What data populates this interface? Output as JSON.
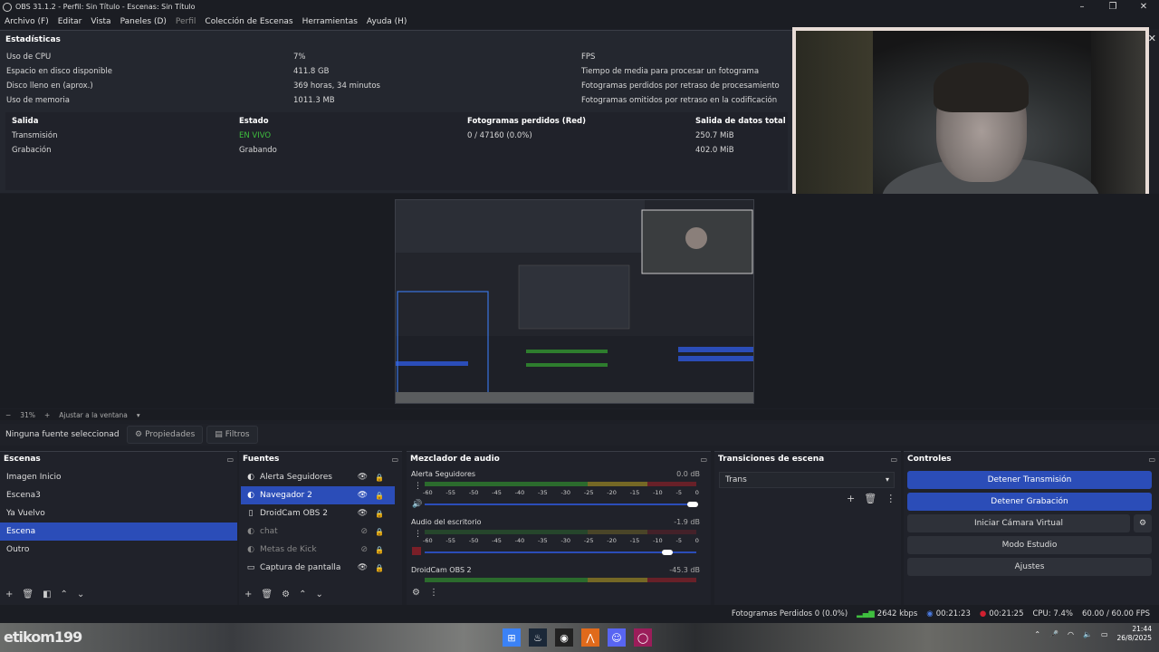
{
  "window": {
    "title": "OBS 31.1.2 - Perfil: Sin Título - Escenas: Sin Título"
  },
  "menu": [
    "Archivo (F)",
    "Editar",
    "Vista",
    "Paneles (D)",
    "Perfil",
    "Colección de Escenas",
    "Herramientas",
    "Ayuda (H)"
  ],
  "stats": {
    "title": "Estadísticas",
    "cpu_label": "Uso de CPU",
    "cpu_value": "7%",
    "disk_label": "Espacio en disco disponible",
    "disk_value": "411.8 GB",
    "full_label": "Disco lleno en (aprox.)",
    "full_value": "369 horas, 34 minutos",
    "mem_label": "Uso de memoria",
    "mem_value": "1011.3 MB",
    "fps_label": "FPS",
    "render_label": "Tiempo de media para procesar un fotograma",
    "dropped_render_label": "Fotogramas perdidos por retraso de procesamiento",
    "skipped_label": "Fotogramas omitidos por retraso en la codificación",
    "out_headers": [
      "Salida",
      "Estado",
      "Fotogramas perdidos (Red)",
      "Salida de datos total"
    ],
    "rows": [
      [
        "Transmisión",
        "EN VIVO",
        "0 / 47160 (0.0%)",
        "250.7 MiB"
      ],
      [
        "Grabación",
        "Grabando",
        "",
        "402.0 MiB"
      ]
    ]
  },
  "zoom": {
    "minus": "−",
    "level": "31%",
    "plus": "+",
    "fit": "Ajustar a la ventana",
    "caret": "▾"
  },
  "props": {
    "no_source": "Ninguna fuente seleccionad",
    "properties": "Propiedades",
    "filters": "Filtros"
  },
  "scenes": {
    "title": "Escenas",
    "items": [
      "Imagen Inicio",
      "Escena3",
      "Ya Vuelvo",
      "Escena",
      "Outro"
    ]
  },
  "sources": {
    "title": "Fuentes",
    "items": [
      "Alerta Seguidores",
      "Navegador 2",
      "DroidCam OBS 2",
      "chat",
      "Metas de Kick",
      "Captura de pantalla"
    ]
  },
  "mixer": {
    "title": "Mezclador de audio",
    "channels": [
      {
        "name": "Alerta Seguidores",
        "db": "0.0 dB"
      },
      {
        "name": "Audio del escritorio",
        "db": "-1.9 dB"
      },
      {
        "name": "DroidCam OBS 2",
        "db": "-45.3 dB"
      }
    ],
    "scale": [
      "-60",
      "-55",
      "-50",
      "-45",
      "-40",
      "-35",
      "-30",
      "-25",
      "-20",
      "-15",
      "-10",
      "-5",
      "0"
    ]
  },
  "transitions": {
    "title": "Transiciones de escena",
    "selected": "Trans"
  },
  "controls": {
    "title": "Controles",
    "stop_stream": "Detener Transmisión",
    "stop_rec": "Detener Grabación",
    "virtual_cam": "Iniciar Cámara Virtual",
    "studio": "Modo Estudio",
    "settings": "Ajustes"
  },
  "status": {
    "dropped": "Fotogramas Perdidos 0 (0.0%)",
    "kbps": "2642 kbps",
    "stream_time": "00:21:23",
    "rec_time": "00:21:25",
    "cpu": "CPU: 7.4%",
    "fps": "60.00 / 60.00 FPS"
  },
  "taskbar": {
    "watermark": "etikom199",
    "time": "21:44",
    "date": "26/8/2025"
  }
}
